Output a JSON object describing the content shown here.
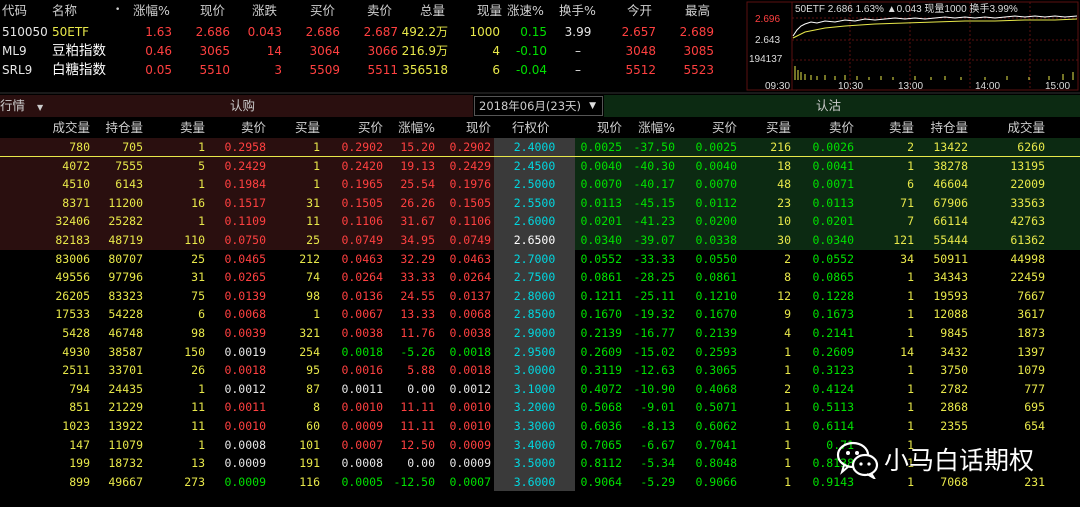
{
  "quote_header": [
    "代码",
    "名称",
    "•",
    "涨幅%",
    "现价",
    "涨跌",
    "买价",
    "卖价",
    "总量",
    "现量",
    "涨速%",
    "换手%",
    "今开",
    "最高"
  ],
  "quotes": [
    {
      "code": "510050",
      "name": "50ETF",
      "chg_pct": "1.63",
      "price": "2.686",
      "chg": "0.043",
      "bid": "2.686",
      "ask": "2.687",
      "volume": "492.2万",
      "cur_vol": "1000",
      "speed": "0.15",
      "turnover": "3.99",
      "open": "2.657",
      "high": "2.689"
    },
    {
      "code": "ML9",
      "name": "豆粕指数",
      "chg_pct": "0.46",
      "price": "3065",
      "chg": "14",
      "bid": "3064",
      "ask": "3066",
      "volume": "216.9万",
      "cur_vol": "4",
      "speed": "-0.10",
      "turnover": "–",
      "open": "3048",
      "high": "3085"
    },
    {
      "code": "SRL9",
      "name": "白糖指数",
      "chg_pct": "0.05",
      "price": "5510",
      "chg": "3",
      "bid": "5509",
      "ask": "5511",
      "volume": "356518",
      "cur_vol": "6",
      "speed": "-0.04",
      "turnover": "–",
      "open": "5512",
      "high": "5523"
    }
  ],
  "mini_chart": {
    "info": "50ETF 2.686 1.63% ▲0.043 现量1000 换手3.99%",
    "y_labels": [
      "2.696",
      "2.643",
      "194137"
    ],
    "x_labels": [
      "09:30",
      "10:30",
      "13:00",
      "14:00",
      "15:00"
    ]
  },
  "toolbar": {
    "left_label": "行情",
    "call_label": "认购",
    "month": "2018年06月(23天)",
    "put_label": "认沽"
  },
  "option_header": [
    "成交量",
    "持仓量",
    "卖量",
    "卖价",
    "买量",
    "买价",
    "涨幅%",
    "现价",
    "行权价",
    "现价",
    "涨幅%",
    "买价",
    "买量",
    "卖价",
    "卖量",
    "持仓量",
    "成交量"
  ],
  "rows": [
    [
      "780",
      "705",
      "1",
      "0.2958",
      "1",
      "0.2902",
      "15.20",
      "0.2902",
      "2.4000",
      "0.0025",
      "-37.50",
      "0.0025",
      "216",
      "0.0026",
      "2",
      "13422",
      "6260"
    ],
    [
      "4072",
      "7555",
      "5",
      "0.2429",
      "1",
      "0.2420",
      "19.13",
      "0.2429",
      "2.4500",
      "0.0040",
      "-40.30",
      "0.0040",
      "18",
      "0.0041",
      "1",
      "38278",
      "13195"
    ],
    [
      "4510",
      "6143",
      "1",
      "0.1984",
      "1",
      "0.1965",
      "25.54",
      "0.1976",
      "2.5000",
      "0.0070",
      "-40.17",
      "0.0070",
      "48",
      "0.0071",
      "6",
      "46604",
      "22009"
    ],
    [
      "8371",
      "11200",
      "16",
      "0.1517",
      "31",
      "0.1505",
      "26.26",
      "0.1505",
      "2.5500",
      "0.0113",
      "-45.15",
      "0.0112",
      "23",
      "0.0113",
      "71",
      "67906",
      "33563"
    ],
    [
      "32406",
      "25282",
      "1",
      "0.1109",
      "11",
      "0.1106",
      "31.67",
      "0.1106",
      "2.6000",
      "0.0201",
      "-41.23",
      "0.0200",
      "10",
      "0.0201",
      "7",
      "66114",
      "42763"
    ],
    [
      "82183",
      "48719",
      "110",
      "0.0750",
      "25",
      "0.0749",
      "34.95",
      "0.0749",
      "2.6500",
      "0.0340",
      "-39.07",
      "0.0338",
      "30",
      "0.0340",
      "121",
      "55444",
      "61362"
    ],
    [
      "83006",
      "80707",
      "25",
      "0.0465",
      "212",
      "0.0463",
      "32.29",
      "0.0463",
      "2.7000",
      "0.0552",
      "-33.33",
      "0.0550",
      "2",
      "0.0552",
      "34",
      "50911",
      "44998"
    ],
    [
      "49556",
      "97796",
      "31",
      "0.0265",
      "74",
      "0.0264",
      "33.33",
      "0.0264",
      "2.7500",
      "0.0861",
      "-28.25",
      "0.0861",
      "8",
      "0.0865",
      "1",
      "34343",
      "22459"
    ],
    [
      "26205",
      "83323",
      "75",
      "0.0139",
      "98",
      "0.0136",
      "24.55",
      "0.0137",
      "2.8000",
      "0.1211",
      "-25.11",
      "0.1210",
      "12",
      "0.1228",
      "1",
      "19593",
      "7667"
    ],
    [
      "17533",
      "54228",
      "6",
      "0.0068",
      "1",
      "0.0067",
      "13.33",
      "0.0068",
      "2.8500",
      "0.1670",
      "-19.32",
      "0.1670",
      "9",
      "0.1673",
      "1",
      "12088",
      "3617"
    ],
    [
      "5428",
      "46748",
      "98",
      "0.0039",
      "321",
      "0.0038",
      "11.76",
      "0.0038",
      "2.9000",
      "0.2139",
      "-16.77",
      "0.2139",
      "4",
      "0.2141",
      "1",
      "9845",
      "1873"
    ],
    [
      "4930",
      "38587",
      "150",
      "0.0019",
      "254",
      "0.0018",
      "-5.26",
      "0.0018",
      "2.9500",
      "0.2609",
      "-15.02",
      "0.2593",
      "1",
      "0.2609",
      "14",
      "3432",
      "1397"
    ],
    [
      "2511",
      "33701",
      "26",
      "0.0018",
      "95",
      "0.0016",
      "5.88",
      "0.0018",
      "3.0000",
      "0.3119",
      "-12.63",
      "0.3065",
      "1",
      "0.3123",
      "1",
      "3750",
      "1079"
    ],
    [
      "794",
      "24435",
      "1",
      "0.0012",
      "87",
      "0.0011",
      "0.00",
      "0.0012",
      "3.1000",
      "0.4072",
      "-10.90",
      "0.4068",
      "2",
      "0.4124",
      "1",
      "2782",
      "777"
    ],
    [
      "851",
      "21229",
      "11",
      "0.0011",
      "8",
      "0.0010",
      "11.11",
      "0.0010",
      "3.2000",
      "0.5068",
      "-9.01",
      "0.5071",
      "1",
      "0.5113",
      "1",
      "2868",
      "695"
    ],
    [
      "1023",
      "13922",
      "11",
      "0.0010",
      "60",
      "0.0009",
      "11.11",
      "0.0010",
      "3.3000",
      "0.6036",
      "-8.13",
      "0.6062",
      "1",
      "0.6114",
      "1",
      "2355",
      "654"
    ],
    [
      "147",
      "11079",
      "1",
      "0.0008",
      "101",
      "0.0007",
      "12.50",
      "0.0009",
      "3.4000",
      "0.7065",
      "-6.67",
      "0.7041",
      "1",
      "0.71",
      "1",
      "",
      "",
      ""
    ],
    [
      "199",
      "18732",
      "13",
      "0.0009",
      "191",
      "0.0008",
      "0.00",
      "0.0009",
      "3.5000",
      "0.8112",
      "-5.34",
      "0.8048",
      "1",
      "0.8138",
      "1",
      "",
      "",
      ""
    ],
    [
      "899",
      "49667",
      "273",
      "0.0009",
      "116",
      "0.0005",
      "-12.50",
      "0.0007",
      "3.6000",
      "0.9064",
      "-5.29",
      "0.9066",
      "1",
      "0.9143",
      "1",
      "7068",
      "231"
    ]
  ],
  "watermark": "小马白话期权",
  "colors": {
    "up": "#ff4040",
    "down": "#00e000",
    "strike": "#00d7e0",
    "callbg": "#2a0f0f",
    "putbg": "#0c2a12"
  }
}
